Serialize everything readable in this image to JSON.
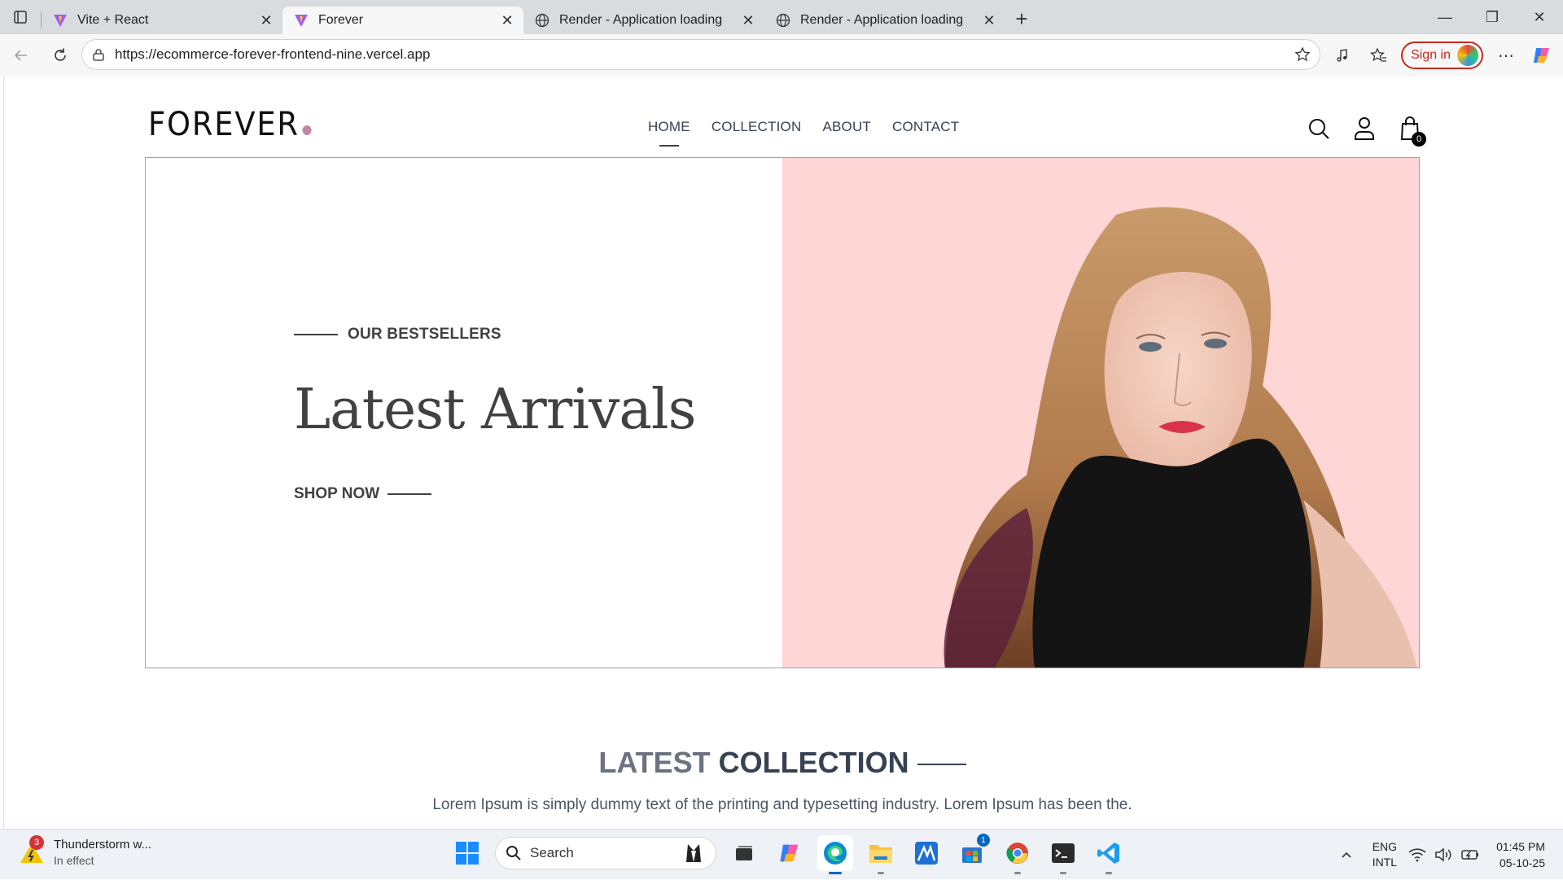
{
  "browser": {
    "tabs": [
      {
        "title": "Vite + React",
        "active": false
      },
      {
        "title": "Forever",
        "active": true
      },
      {
        "title": "Render - Application loading",
        "active": false
      },
      {
        "title": "Render - Application loading",
        "active": false
      }
    ],
    "url": "https://ecommerce-forever-frontend-nine.vercel.app",
    "signin_label": "Sign in"
  },
  "site": {
    "logo": "FOREVER",
    "nav": [
      "HOME",
      "COLLECTION",
      "ABOUT",
      "CONTACT"
    ],
    "cart_count": "0",
    "hero": {
      "eyebrow": "OUR BESTSELLERS",
      "title": "Latest Arrivals",
      "cta": "SHOP NOW",
      "bg_color": "#ffd6d6"
    },
    "latest": {
      "title_light": "LATEST",
      "title_bold": "COLLECTION",
      "subtitle": "Lorem Ipsum is simply dummy text of the printing and typesetting industry. Lorem Ipsum has been the."
    }
  },
  "taskbar": {
    "weather_title": "Thunderstorm w...",
    "weather_sub": "In effect",
    "weather_badge": "3",
    "search_placeholder": "Search",
    "store_badge": "1",
    "lang_top": "ENG",
    "lang_bottom": "INTL",
    "time": "01:45 PM",
    "date": "05-10-25"
  }
}
